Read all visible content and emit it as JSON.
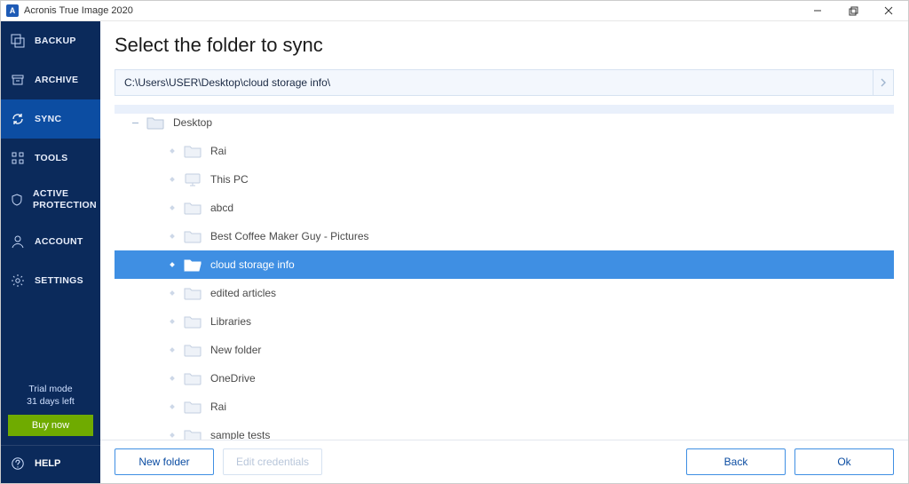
{
  "app": {
    "title": "Acronis True Image 2020",
    "icon_letter": "A"
  },
  "window_controls": {
    "minimize": "–",
    "maximize": "❐",
    "close": "✕"
  },
  "sidebar": {
    "items": [
      {
        "label": "BACKUP"
      },
      {
        "label": "ARCHIVE"
      },
      {
        "label": "SYNC",
        "active": true
      },
      {
        "label": "TOOLS"
      },
      {
        "label": "ACTIVE PROTECTION"
      },
      {
        "label": "ACCOUNT"
      },
      {
        "label": "SETTINGS"
      }
    ],
    "trial_line1": "Trial mode",
    "trial_line2": "31 days left",
    "buy_label": "Buy now",
    "help_label": "HELP"
  },
  "page": {
    "title": "Select the folder to sync",
    "path_value": "C:\\Users\\USER\\Desktop\\cloud storage info\\"
  },
  "tree": {
    "root": {
      "label": "Desktop"
    },
    "children": [
      {
        "label": "Rai",
        "icon": "folder",
        "selected": false
      },
      {
        "label": "This PC",
        "icon": "monitor",
        "selected": false
      },
      {
        "label": "abcd",
        "icon": "folder",
        "selected": false
      },
      {
        "label": "Best Coffee Maker Guy - Pictures",
        "icon": "folder",
        "selected": false
      },
      {
        "label": "cloud storage info",
        "icon": "folder-open",
        "selected": true
      },
      {
        "label": "edited articles",
        "icon": "folder",
        "selected": false
      },
      {
        "label": "Libraries",
        "icon": "folder",
        "selected": false
      },
      {
        "label": "New folder",
        "icon": "folder",
        "selected": false
      },
      {
        "label": "OneDrive",
        "icon": "folder",
        "selected": false
      },
      {
        "label": "Rai",
        "icon": "folder",
        "selected": false
      },
      {
        "label": "sample tests",
        "icon": "folder",
        "selected": false
      }
    ]
  },
  "footer": {
    "new_folder": "New folder",
    "edit_credentials": "Edit credentials",
    "back": "Back",
    "ok": "Ok"
  }
}
